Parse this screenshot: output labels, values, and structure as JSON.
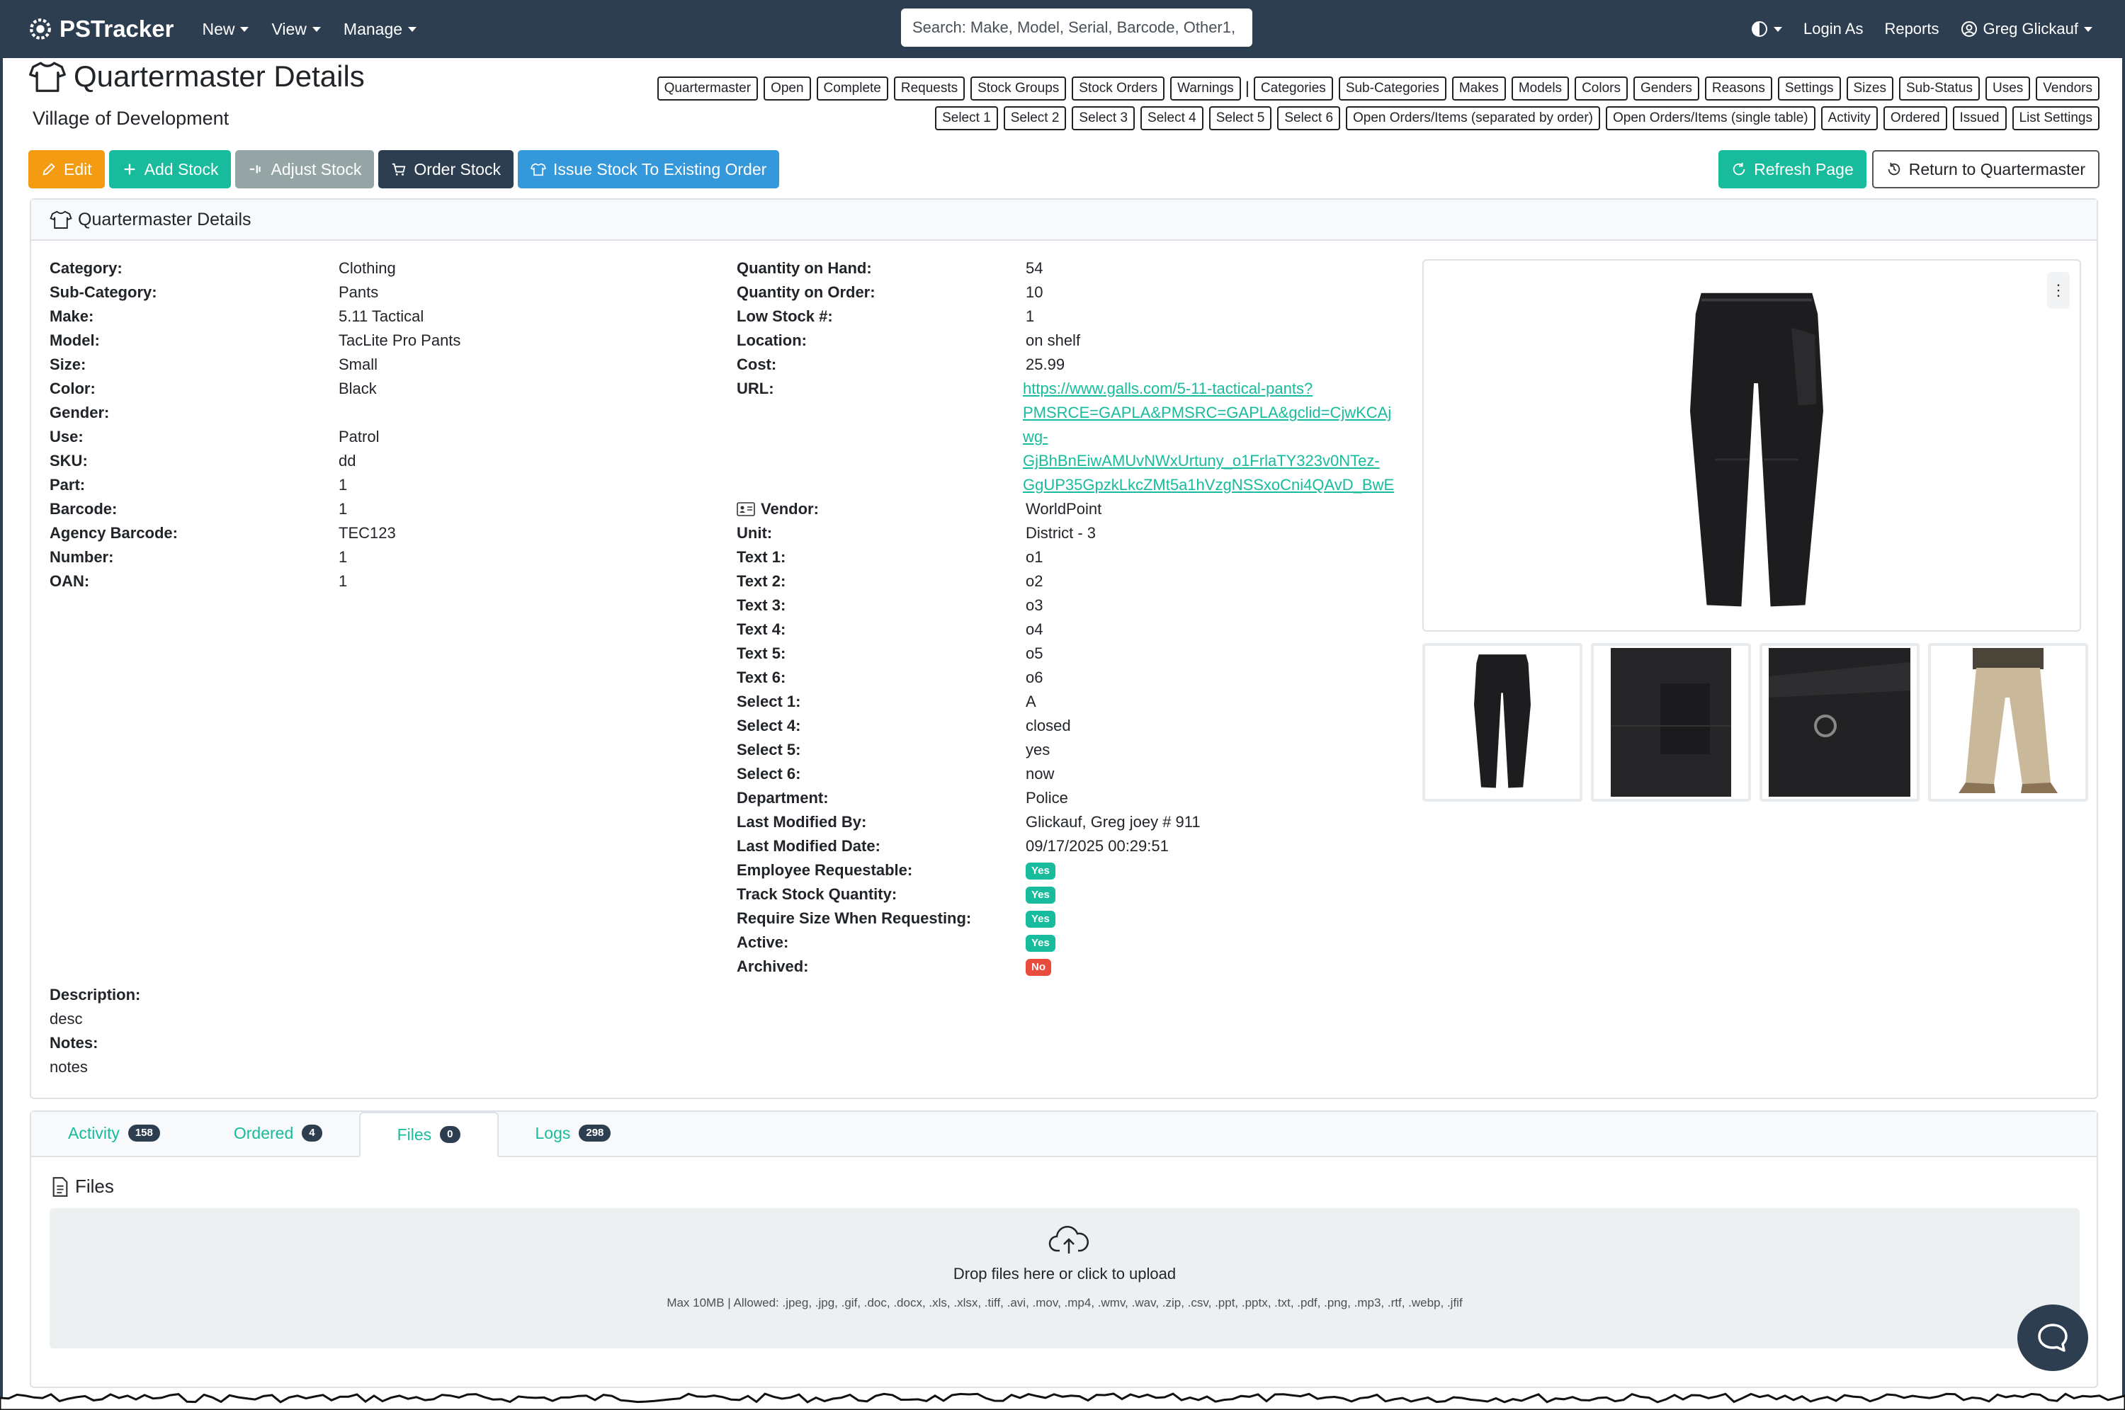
{
  "navbar": {
    "brand": "PSTracker",
    "menu": [
      {
        "label": "New"
      },
      {
        "label": "View"
      },
      {
        "label": "Manage"
      }
    ],
    "search_placeholder": "Search: Make, Model, Serial, Barcode, Other1,",
    "login_as": "Login As",
    "reports": "Reports",
    "user": "Greg Glickauf"
  },
  "header": {
    "title": "Quartermaster Details",
    "subtitle": "Village of Development"
  },
  "section_buttons_row1": [
    "Quartermaster",
    "Open",
    "Complete",
    "Requests",
    "Stock Groups",
    "Stock Orders",
    "Warnings",
    "|",
    "Categories",
    "Sub-Categories",
    "Makes",
    "Models",
    "Colors",
    "Genders",
    "Reasons",
    "Settings",
    "Sizes",
    "Sub-Status",
    "Uses",
    "Vendors"
  ],
  "section_buttons_row2": [
    "Select 1",
    "Select 2",
    "Select 3",
    "Select 4",
    "Select 5",
    "Select 6",
    "Open Orders/Items (separated by order)",
    "Open Orders/Items (single table)",
    "Activity",
    "Ordered",
    "Issued",
    "List Settings"
  ],
  "actions": {
    "edit": "Edit",
    "add_stock": "Add Stock",
    "adjust_stock": "Adjust Stock",
    "order_stock": "Order Stock",
    "issue_stock": "Issue Stock To Existing Order",
    "refresh": "Refresh Page",
    "return": "Return to Quartermaster"
  },
  "card": {
    "title": "Quartermaster Details",
    "left_fields": [
      {
        "label": "Category:",
        "value": "Clothing"
      },
      {
        "label": "Sub-Category:",
        "value": "Pants"
      },
      {
        "label": "Make:",
        "value": "5.11 Tactical"
      },
      {
        "label": "Model:",
        "value": "TacLite Pro Pants"
      },
      {
        "label": "Size:",
        "value": "Small"
      },
      {
        "label": "Color:",
        "value": "Black"
      },
      {
        "label": "Gender:",
        "value": ""
      },
      {
        "label": "Use:",
        "value": "Patrol"
      },
      {
        "label": "SKU:",
        "value": "dd"
      },
      {
        "label": "Part:",
        "value": "1"
      },
      {
        "label": "Barcode:",
        "value": "1"
      },
      {
        "label": "Agency Barcode:",
        "value": "TEC123"
      },
      {
        "label": "Number:",
        "value": "1"
      },
      {
        "label": "OAN:",
        "value": "1"
      }
    ],
    "right_fields_top": [
      {
        "label": "Quantity on Hand:",
        "value": "54"
      },
      {
        "label": "Quantity on Order:",
        "value": "10"
      },
      {
        "label": "Low Stock #:",
        "value": "1"
      },
      {
        "label": "Location:",
        "value": "on shelf"
      },
      {
        "label": "Cost:",
        "value": "25.99"
      }
    ],
    "url_label": "URL:",
    "url_lines": [
      "https://www.galls.com/5-11-tactical-pants?",
      "PMSRCE=GAPLA&PMSRC=GAPLA&gclid=CjwKCAj",
      "wg-",
      "GjBhBnEiwAMUvNWxUrtuny_o1FrlaTY323v0NTez-",
      "GgUP35GpzkLkcZMt5a1hVzgNSSxoCni4QAvD_BwE"
    ],
    "vendor_label": "Vendor:",
    "vendor_value": "WorldPoint",
    "right_fields_bottom": [
      {
        "label": "Unit:",
        "value": "District - 3"
      },
      {
        "label": "Text 1:",
        "value": "o1"
      },
      {
        "label": "Text 2:",
        "value": "o2"
      },
      {
        "label": "Text 3:",
        "value": "o3"
      },
      {
        "label": "Text 4:",
        "value": "o4"
      },
      {
        "label": "Text 5:",
        "value": "o5"
      },
      {
        "label": "Text 6:",
        "value": "o6"
      },
      {
        "label": "Select 1:",
        "value": "A"
      },
      {
        "label": "Select 4:",
        "value": "closed"
      },
      {
        "label": "Select 5:",
        "value": "yes"
      },
      {
        "label": "Select 6:",
        "value": "now"
      },
      {
        "label": "Department:",
        "value": "Police"
      },
      {
        "label": "Last Modified By:",
        "value": "Glickauf, Greg joey # 911"
      },
      {
        "label": "Last Modified Date:",
        "value": "09/17/2025 00:29:51"
      }
    ],
    "flags": [
      {
        "label": "Employee Requestable:",
        "value": "Yes",
        "color": "#18bc9c"
      },
      {
        "label": "Track Stock Quantity:",
        "value": "Yes",
        "color": "#18bc9c"
      },
      {
        "label": "Require Size When Requesting:",
        "value": "Yes",
        "color": "#18bc9c"
      },
      {
        "label": "Active:",
        "value": "Yes",
        "color": "#18bc9c"
      },
      {
        "label": "Archived:",
        "value": "No",
        "color": "#e74c3c"
      }
    ],
    "description_label": "Description:",
    "description": "desc",
    "notes_label": "Notes:",
    "notes": "notes",
    "kebab": "⋮"
  },
  "tabs": [
    {
      "label": "Activity",
      "count": "158"
    },
    {
      "label": "Ordered",
      "count": "4"
    },
    {
      "label": "Files",
      "count": "0"
    },
    {
      "label": "Logs",
      "count": "298"
    }
  ],
  "files": {
    "title": "Files",
    "drop_text": "Drop files here or click to upload",
    "allowed_text": "Max 10MB | Allowed: .jpeg, .jpg, .gif, .doc, .docx, .xls, .xlsx, .tiff, .avi, .mov, .mp4, .wmv, .wav, .zip, .csv, .ppt, .pptx, .txt, .pdf, .png, .mp3, .rtf, .webp, .jfif"
  },
  "colors": {
    "navbar": "#2c3e50",
    "accent": "#18bc9c",
    "edit": "#f39c12",
    "info": "#3498db",
    "danger": "#e74c3c"
  }
}
